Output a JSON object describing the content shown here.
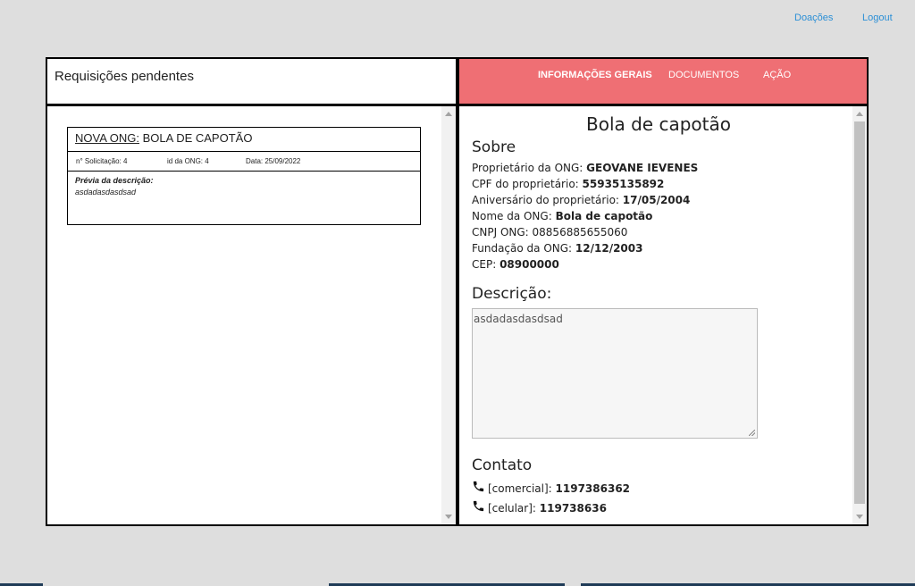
{
  "topnav": {
    "donations": "Doações",
    "logout": "Logout"
  },
  "left_panel": {
    "title": "Requisições pendentes",
    "cards": [
      {
        "prefix": "NOVA ONG:",
        "name": " BOLA DE CAPOTÃO",
        "request_no": "n° Solicitação: 4",
        "ong_id": "id da ONG: 4",
        "date": "Data: 25/09/2022",
        "preview_label": "Prévia da descrição:",
        "preview_text": "asdadasdasdsad"
      }
    ]
  },
  "right_panel": {
    "tabs": [
      "INFORMAÇÕES GERAIS",
      "DOCUMENTOS",
      "AÇÃO"
    ],
    "active_tab": "INFORMAÇÕES GERAIS",
    "ong_name": "Bola de capotão",
    "about_title": "Sobre",
    "fields": [
      {
        "label": "Proprietário da ONG: ",
        "value": "GEOVANE IEVENES",
        "bold": true
      },
      {
        "label": "CPF do proprietário: ",
        "value": "55935135892",
        "bold": true
      },
      {
        "label": "Aniversário do proprietário: ",
        "value": "17/05/2004",
        "bold": true
      },
      {
        "label": "Nome da ONG: ",
        "value": "Bola de capotão",
        "bold": true
      },
      {
        "label": "CNPJ ONG: ",
        "value": "08856885655060",
        "bold": false
      },
      {
        "label": "Fundação da ONG: ",
        "value": "12/12/2003",
        "bold": true
      },
      {
        "label": "CEP: ",
        "value": "08900000",
        "bold": true
      }
    ],
    "description_title": "Descrição:",
    "description": "asdadasdasdsad",
    "contact_title": "Contato",
    "contacts": [
      {
        "type": "[comercial]: ",
        "number": "1197386362"
      },
      {
        "type": "[celular]: ",
        "number": "119738636"
      }
    ]
  },
  "colors": {
    "header_accent": "#ef6f74",
    "link": "#2b8fd6",
    "background": "#dedede"
  }
}
